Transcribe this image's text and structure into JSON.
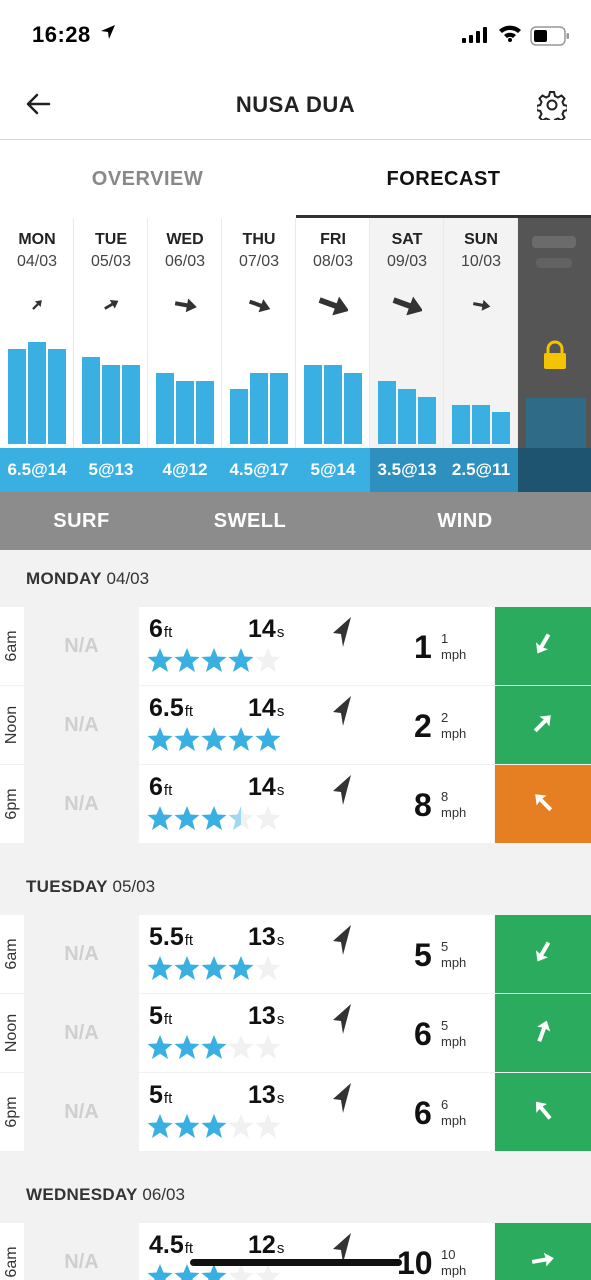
{
  "status": {
    "time": "16:28"
  },
  "header": {
    "title": "NUSA DUA"
  },
  "tabs": [
    {
      "label": "OVERVIEW"
    },
    {
      "label": "FORECAST"
    }
  ],
  "days": [
    {
      "name": "MON",
      "date": "04/03",
      "wave": "6.5@14",
      "bars": [
        0.75,
        0.81,
        0.75
      ],
      "wind_dir": 45,
      "wind_size": 8,
      "weekend": false
    },
    {
      "name": "TUE",
      "date": "05/03",
      "wave": "5@13",
      "bars": [
        0.69,
        0.63,
        0.63
      ],
      "wind_dir": 60,
      "wind_size": 10,
      "weekend": false
    },
    {
      "name": "WED",
      "date": "06/03",
      "wave": "4@12",
      "bars": [
        0.56,
        0.5,
        0.5
      ],
      "wind_dir": 100,
      "wind_size": 14,
      "weekend": false
    },
    {
      "name": "THU",
      "date": "07/03",
      "wave": "4.5@17",
      "bars": [
        0.44,
        0.56,
        0.56
      ],
      "wind_dir": 110,
      "wind_size": 14,
      "weekend": false
    },
    {
      "name": "FRI",
      "date": "08/03",
      "wave": "5@14",
      "bars": [
        0.63,
        0.63,
        0.56
      ],
      "wind_dir": 110,
      "wind_size": 20,
      "weekend": false
    },
    {
      "name": "SAT",
      "date": "09/03",
      "wave": "3.5@13",
      "bars": [
        0.5,
        0.44,
        0.37
      ],
      "wind_dir": 110,
      "wind_size": 20,
      "weekend": true
    },
    {
      "name": "SUN",
      "date": "10/03",
      "wave": "2.5@11",
      "bars": [
        0.31,
        0.31,
        0.25
      ],
      "wind_dir": 100,
      "wind_size": 11,
      "weekend": true
    }
  ],
  "columns": {
    "surf": "SURF",
    "swell": "SWELL",
    "wind": "WIND"
  },
  "sections": [
    {
      "day": "MONDAY",
      "date": "04/03",
      "rows": [
        {
          "time": "6am",
          "surf": "N/A",
          "height": "6",
          "height_unit": "ft",
          "period": "14",
          "period_unit": "s",
          "stars": 4,
          "wind": "1",
          "wind_small": "1",
          "wind_unit": "mph",
          "wind_color": "#2bab5e",
          "wind_arrow": 210
        },
        {
          "time": "Noon",
          "surf": "N/A",
          "height": "6.5",
          "height_unit": "ft",
          "period": "14",
          "period_unit": "s",
          "stars": 5,
          "wind": "2",
          "wind_small": "2",
          "wind_unit": "mph",
          "wind_color": "#2bab5e",
          "wind_arrow": 45
        },
        {
          "time": "6pm",
          "surf": "N/A",
          "height": "6",
          "height_unit": "ft",
          "period": "14",
          "period_unit": "s",
          "stars": 3.5,
          "wind": "8",
          "wind_small": "8",
          "wind_unit": "mph",
          "wind_color": "#e67e22",
          "wind_arrow": 315
        }
      ]
    },
    {
      "day": "TUESDAY",
      "date": "05/03",
      "rows": [
        {
          "time": "6am",
          "surf": "N/A",
          "height": "5.5",
          "height_unit": "ft",
          "period": "13",
          "period_unit": "s",
          "stars": 4,
          "wind": "5",
          "wind_small": "5",
          "wind_unit": "mph",
          "wind_color": "#2bab5e",
          "wind_arrow": 210
        },
        {
          "time": "Noon",
          "surf": "N/A",
          "height": "5",
          "height_unit": "ft",
          "period": "13",
          "period_unit": "s",
          "stars": 3,
          "wind": "6",
          "wind_small": "5",
          "wind_unit": "mph",
          "wind_color": "#2bab5e",
          "wind_arrow": 20
        },
        {
          "time": "6pm",
          "surf": "N/A",
          "height": "5",
          "height_unit": "ft",
          "period": "13",
          "period_unit": "s",
          "stars": 3,
          "wind": "6",
          "wind_small": "6",
          "wind_unit": "mph",
          "wind_color": "#2bab5e",
          "wind_arrow": 320
        }
      ]
    },
    {
      "day": "WEDNESDAY",
      "date": "06/03",
      "rows": [
        {
          "time": "6am",
          "surf": "N/A",
          "height": "4.5",
          "height_unit": "ft",
          "period": "12",
          "period_unit": "s",
          "stars": 3,
          "wind": "10",
          "wind_small": "10",
          "wind_unit": "mph",
          "wind_color": "#2bab5e",
          "wind_arrow": 80
        }
      ]
    }
  ]
}
